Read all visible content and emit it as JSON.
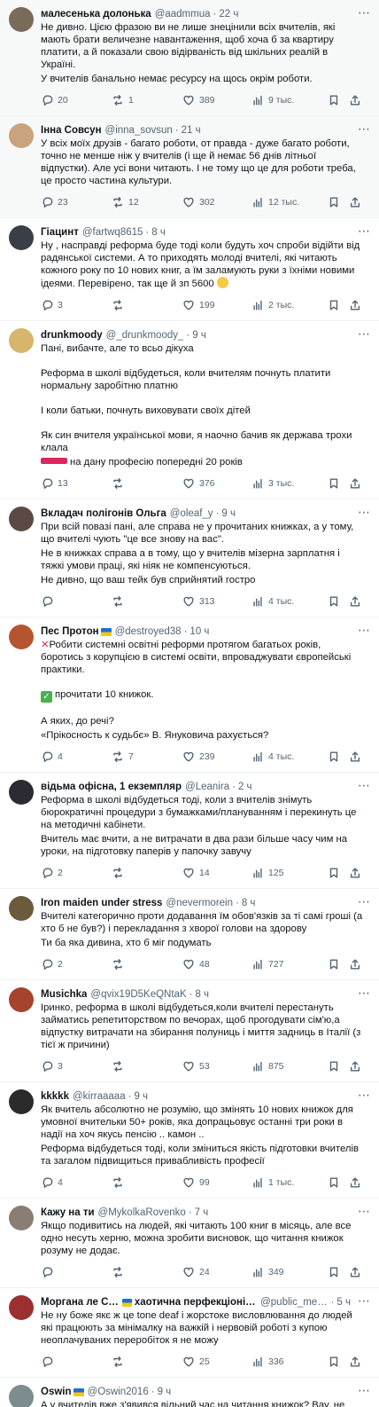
{
  "tweets": [
    {
      "name": "малесенька долонька",
      "handle": "@aadmmua",
      "time": "22 ч",
      "shaded": true,
      "avatar_color": "#7a6a5a",
      "lines": [
        "Не дивно. Цією фразою ви не лише знецінили всіх вчителів, які мають брати величезне навантаження, щоб хоча б за квартиру платити, а й показали свою відірваність від шкільних реалій в Україні.",
        "У вчителів банально немає ресурсу на щось окрім роботи."
      ],
      "replies": "20",
      "reposts": "1",
      "likes": "389",
      "views": "9 тыс."
    },
    {
      "name": "Інна Совсун",
      "handle": "@inna_sovsun",
      "time": "21 ч",
      "shaded": true,
      "avatar_color": "#c9a27e",
      "lines": [
        "У всіх моїх друзів - багато роботи, от правда - дуже багато роботи, точно не менше ніж у вчителів (і ще й немає 56 днів літньої відпустки). Але усі вони читають. І не тому що це для роботи треба, це просто частина культури."
      ],
      "replies": "23",
      "reposts": "12",
      "likes": "302",
      "views": "12 тыс."
    },
    {
      "name": "Гіацинт",
      "handle": "@fartwq8615",
      "time": "8 ч",
      "shaded": false,
      "avatar_color": "#3a3f47",
      "lines": [
        "Ну , насправді реформа буде тоді коли будуть хоч спроби відійти від радянської системи. А то приходять молоді вчителі, які читають кожного року по 10 нових книг, а їм заламують руки з їхніми новими ідеями. Перевірено, так ще й зп 5600"
      ],
      "emoji_after": true,
      "replies": "3",
      "reposts": "",
      "likes": "199",
      "views": "2 тыс."
    },
    {
      "name": "drunkmoody",
      "handle": "@_drunkmoody_",
      "time": "9 ч",
      "shaded": false,
      "avatar_color": "#d7b56d",
      "lines": [
        "Пані, вибачте, але то всьо дікуха",
        "",
        "Реформа в школі відбудеться, коли вчителям почнуть платити нормальну заробітню платню",
        "",
        "І коли батьки, почнуть виховувати своїх дітей",
        "",
        "Як син вчителя української мови, я наочно бачив як держава трохи клала",
        "на дану професію попередні 20 років"
      ],
      "redmark_line": 7,
      "replies": "13",
      "reposts": "",
      "likes": "376",
      "views": "3 тыс."
    },
    {
      "name": "Вкладач полігонів Ольга",
      "handle": "@oleaf_y",
      "time": "9 ч",
      "shaded": false,
      "avatar_color": "#5b4a44",
      "lines": [
        "При всій повазі пані, але справа не у прочитаних книжках, а у тому, що вчителі чують \"це все знову на вас\".",
        "Не в книжках справа а в тому, що у вчителів мізерна зарплатня і тяжкі умови праці, які ніяк не компенсуються.",
        "Не дивно, що ваш тейк був сприйнятий гостро"
      ],
      "replies": "",
      "reposts": "",
      "likes": "313",
      "views": "4 тыс."
    },
    {
      "name": "Пес Протон",
      "handle": "@destroyed38",
      "time": "10 ч",
      "shaded": false,
      "flag": true,
      "avatar_color": "#b5552f",
      "lines": [
        "Робити системні освітні реформи протягом багатьох років, боротись з корупцією в системі освіти, впроваджувати європейські практики.",
        "",
        "прочитати 10 книжок.",
        "",
        "А яких, до речі?",
        "«Прікосность к судьбє» В. Януковича рахується?"
      ],
      "redx_line": 0,
      "check_line": 2,
      "replies": "4",
      "reposts": "7",
      "likes": "239",
      "views": "4 тыс."
    },
    {
      "name": "відьма офісна, 1 екземпляр",
      "handle": "@Leanira",
      "time": "2 ч",
      "shaded": false,
      "avatar_color": "#2c2a33",
      "lines": [
        "Реформа в школі відбудеться тоді, коли з вчителів знімуть бюрократичні процедури з бумажками/плануванням і перекинуть це на методичні кабінети.",
        "Вчитель має вчити, а не витрачати в два рази більше часу чим на уроки, на підготовку паперів у папочку завучу"
      ],
      "replies": "2",
      "reposts": "",
      "likes": "14",
      "views": "125"
    },
    {
      "name": "Iron maiden under stress",
      "handle": "@nevermorein",
      "time": "8 ч",
      "shaded": false,
      "avatar_color": "#6b5a3c",
      "lines": [
        "Вчителі категорично проти додавання їм обов'язків за ті самі гроші (а хто б не був?) і перекладання з хворої голови на здорову",
        "Ти ба яка дивина, хто б міг подумать"
      ],
      "replies": "2",
      "reposts": "",
      "likes": "48",
      "views": "727"
    },
    {
      "name": "Musichka",
      "handle": "@qvix19D5KeQNtaK",
      "time": "8 ч",
      "shaded": false,
      "avatar_color": "#a5432f",
      "lines": [
        "Іринко, реформа в школі відбудеться,коли вчителі перестануть займатись репетиторством по вечорах, щоб прогодувати сім'ю,а відпустку витрачати на збирання полуниць і миття задниць в Італії (з тієї ж причини)"
      ],
      "replies": "3",
      "reposts": "",
      "likes": "53",
      "views": "875"
    },
    {
      "name": "kkkkk",
      "handle": "@kirraaaaa",
      "time": "9 ч",
      "shaded": false,
      "avatar_color": "#2b2b2b",
      "lines": [
        "Як вчитель абсолютно не розумію, що змінять 10 нових книжок для умовної вчительки 50+ років, яка допрацьовує останні три роки в надії на хоч якусь пенсію .. камон ..",
        "Реформа відбудеться тоді, коли зміниться якість підготовки вчителів та загалом підвищиться привабливість професії"
      ],
      "replies": "4",
      "reposts": "",
      "likes": "99",
      "views": "1 тыс."
    },
    {
      "name": "Кажу на ти",
      "handle": "@MykolkaRovenko",
      "time": "7 ч",
      "shaded": false,
      "avatar_color": "#8a7d74",
      "lines": [
        "Якщо подивитись на людей, які читають 100 книг в місяць, але все одно несуть херню, можна зробити висновок, що читання книжок розуму не додає."
      ],
      "replies": "",
      "reposts": "",
      "likes": "24",
      "views": "349"
    },
    {
      "name": "Моргана ле Слей",
      "title_suffix": "хаотична перфекціоністка",
      "handle": "@public_mental",
      "time": "5 ч",
      "shaded": false,
      "flag": true,
      "avatar_color": "#9c2f2f",
      "lines": [
        "Не ну боже якє ж це tone deaf і жорстоке висловлювання до людей які працюють за мінімалку на важкій і нервовій роботі з купою неоплачуваних переробіток я не можу"
      ],
      "replies": "",
      "reposts": "",
      "likes": "25",
      "views": "336"
    },
    {
      "name": "Oswin",
      "handle": "@Oswin2016",
      "time": "9 ч",
      "shaded": false,
      "flag": true,
      "avatar_color": "#7d8c8f",
      "lines": [
        "А у вчителів вже з'явився вільний час на читання книжок? Вау, не знала. А ще у вчителів зп вже 20 тисяч, щоб їх купувати і пенсія 15 тисяч, і їм не треба після 60 років працювати?"
      ],
      "replies": "4",
      "reposts": "",
      "likes": "89",
      "views": "1 тыс."
    }
  ],
  "icons": {
    "reply": "reply-icon",
    "repost": "repost-icon",
    "like": "like-icon",
    "views": "views-icon",
    "bookmark": "bookmark-icon",
    "share": "share-icon",
    "more": "more-icon"
  }
}
